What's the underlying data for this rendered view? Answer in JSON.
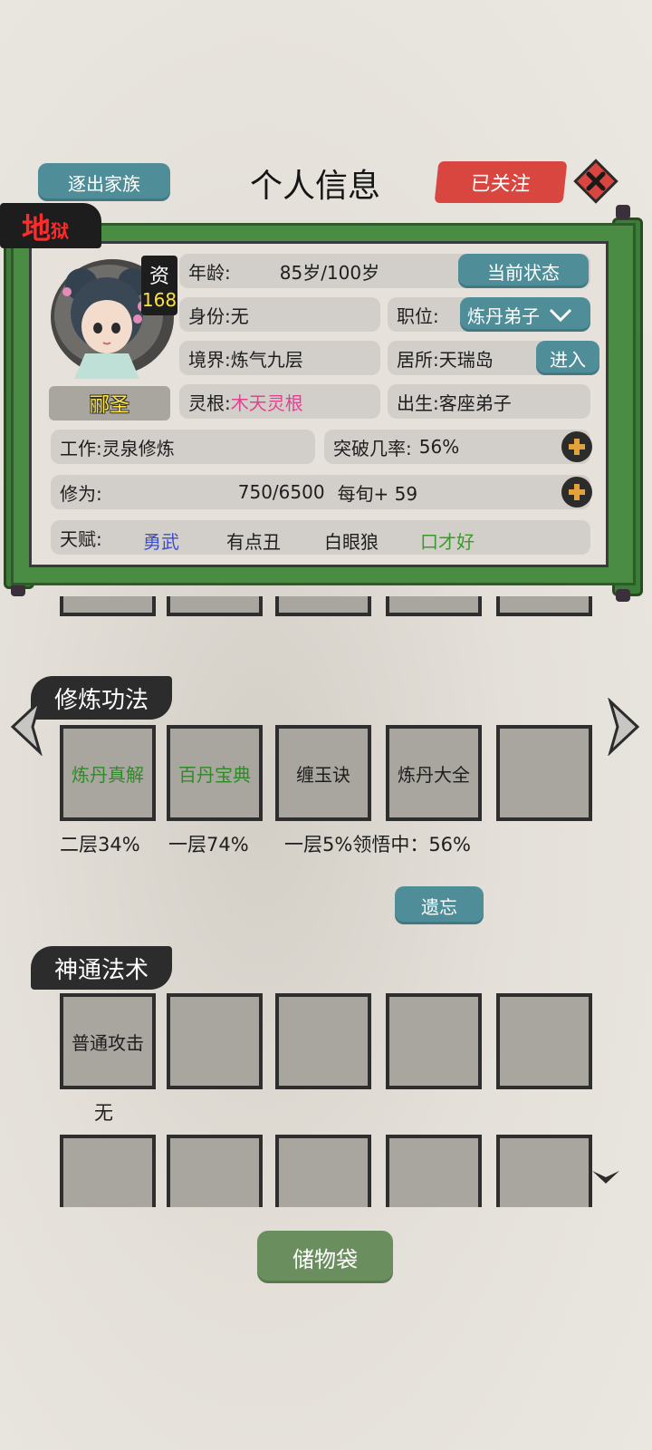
{
  "header": {
    "expel_label": "逐出家族",
    "title": "个人信息",
    "follow_label": "已关注"
  },
  "badge": {
    "main": "地",
    "sub": "狱"
  },
  "profile": {
    "aptitude_label": "资",
    "aptitude_value": "168",
    "name": "郦圣",
    "age_label": "年龄:",
    "age_value": "85岁/100岁",
    "status_button": "当前状态",
    "identity_label": "身份:",
    "identity_value": "无",
    "position_label": "职位:",
    "position_value": "炼丹弟子",
    "realm_label": "境界:",
    "realm_value": "炼气九层",
    "residence_label": "居所:",
    "residence_value": "天瑞岛",
    "enter_button": "进入",
    "spirit_root_label": "灵根:",
    "spirit_root_value": "木天灵根",
    "origin_label": "出生:",
    "origin_value": "客座弟子",
    "work_label": "工作:",
    "work_value": "灵泉修炼",
    "breakthrough_label": "突破几率:",
    "breakthrough_value": "56%",
    "cultivation_label": "修为:",
    "cultivation_value": "750/6500",
    "cultivation_rate": "每旬+ 59",
    "talent_label": "天赋:",
    "talents": [
      {
        "text": "勇武",
        "color": "#3a4fd0"
      },
      {
        "text": "有点丑",
        "color": "#1e1e1e"
      },
      {
        "text": "白眼狼",
        "color": "#1e1e1e"
      },
      {
        "text": "口才好",
        "color": "#3a9a2a"
      }
    ]
  },
  "techniques": {
    "section_title": "修炼功法",
    "slots": [
      {
        "name": "炼丹真解",
        "color": "#2f8a28"
      },
      {
        "name": "百丹宝典",
        "color": "#2f8a28"
      },
      {
        "name": "缠玉诀",
        "color": "#1e1e1e"
      },
      {
        "name": "炼丹大全",
        "color": "#1e1e1e"
      },
      {
        "name": "",
        "color": "#1e1e1e"
      }
    ],
    "progress": [
      "二层34%",
      "一层74%",
      "一层5%领悟中：56%"
    ],
    "forget_button": "遗忘"
  },
  "spells": {
    "section_title": "神通法术",
    "slots_row1": [
      "普通攻击",
      "",
      "",
      "",
      ""
    ],
    "slot1_note": "无"
  },
  "bag_button": "储物袋",
  "colors": {
    "accent_blue": "#4f8e99",
    "accent_green": "#6b8e5e",
    "follow_red": "#d9453f",
    "frame_green": "#4a8c44",
    "spirit_root_pink": "#e0448e",
    "name_yellow": "#ffe23a"
  },
  "icons": [
    "close-icon",
    "plus-icon",
    "chevron-down-icon",
    "arrow-left-icon",
    "arrow-right-icon",
    "scroll-down-icon"
  ]
}
